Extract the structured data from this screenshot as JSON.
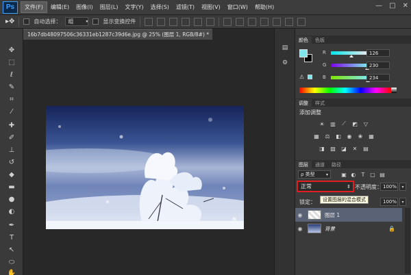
{
  "app": {
    "logo": "Ps"
  },
  "menu": [
    "文件(F)",
    "编辑(E)",
    "图像(I)",
    "图层(L)",
    "文字(Y)",
    "选择(S)",
    "滤镜(T)",
    "视图(V)",
    "窗口(W)",
    "帮助(H)"
  ],
  "window_controls": [
    "—",
    "□",
    "✕"
  ],
  "options_bar": {
    "auto_select_label": "自动选择：",
    "auto_select_value": "组",
    "show_transform_label": "显示变换控件"
  },
  "document": {
    "tab_title": "16b7db48097506c36331eb1287c39d6e.jpg @ 25% (图层 1, RGB/8#) *",
    "tab_close": "×"
  },
  "color_panel": {
    "tabs": [
      "颜色",
      "色板"
    ],
    "rows": [
      {
        "label": "R",
        "value": "126"
      },
      {
        "label": "G",
        "value": "230"
      },
      {
        "label": "B",
        "value": "234"
      }
    ],
    "foreground": "#7ee6ea",
    "background": "#000000"
  },
  "adjust_panel": {
    "tabs": [
      "调整",
      "样式"
    ],
    "heading": "添加调整"
  },
  "layers_panel": {
    "tabs": [
      "图层",
      "通道",
      "路径"
    ],
    "kind_label": "ρ 类型",
    "blend_mode": "正常",
    "opacity_label": "不透明度：",
    "opacity_value": "100%",
    "tooltip": "设置图层的混合模式",
    "lock_label": "锁定：",
    "fill_value": "100%",
    "layers": [
      {
        "name": "图层 1",
        "selected": true
      },
      {
        "name": "背景",
        "selected": false,
        "locked": true
      }
    ]
  },
  "colors": {
    "highlight": "#e41e1e",
    "selected_layer": "#5a6276",
    "panel": "#3a3a3a"
  }
}
